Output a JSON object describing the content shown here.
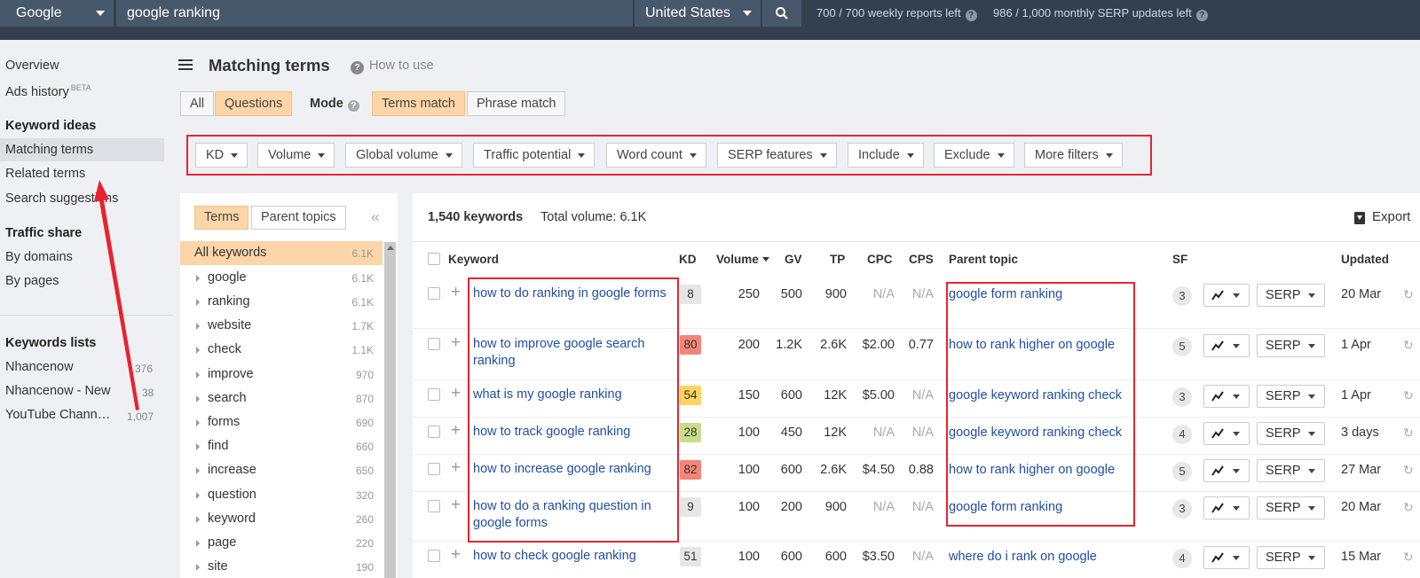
{
  "topbar": {
    "engine": "Google",
    "query": "google ranking",
    "country": "United States",
    "reports_left": "700 / 700 weekly reports left",
    "serp_updates_left": "986 / 1,000 monthly SERP updates left"
  },
  "sidebar": {
    "overview": "Overview",
    "ads_history": "Ads history",
    "beta": "BETA",
    "keyword_ideas": "Keyword ideas",
    "matching_terms": "Matching terms",
    "related_terms": "Related terms",
    "search_suggestions": "Search suggestions",
    "traffic_share": "Traffic share",
    "by_domains": "By domains",
    "by_pages": "By pages",
    "keywords_lists": "Keywords lists",
    "lists": [
      {
        "name": "Nhancenow",
        "count": "376"
      },
      {
        "name": "Nhancenow - New",
        "count": "38"
      },
      {
        "name": "YouTube Chann…",
        "count": "1,007"
      }
    ]
  },
  "header": {
    "title": "Matching terms",
    "how_to_use": "How to use",
    "tab_all": "All",
    "tab_questions": "Questions",
    "mode": "Mode",
    "terms_match": "Terms match",
    "phrase_match": "Phrase match"
  },
  "filters": [
    "KD",
    "Volume",
    "Global volume",
    "Traffic potential",
    "Word count",
    "SERP features",
    "Include",
    "Exclude",
    "More filters"
  ],
  "left_panel": {
    "tab_terms": "Terms",
    "tab_parent_topics": "Parent topics",
    "all_keywords": {
      "name": "All keywords",
      "count": "6.1K"
    },
    "terms": [
      {
        "name": "google",
        "count": "6.1K"
      },
      {
        "name": "ranking",
        "count": "6.1K"
      },
      {
        "name": "website",
        "count": "1.7K"
      },
      {
        "name": "check",
        "count": "1.1K"
      },
      {
        "name": "improve",
        "count": "970"
      },
      {
        "name": "search",
        "count": "870"
      },
      {
        "name": "forms",
        "count": "690"
      },
      {
        "name": "find",
        "count": "660"
      },
      {
        "name": "increase",
        "count": "650"
      },
      {
        "name": "question",
        "count": "320"
      },
      {
        "name": "keyword",
        "count": "260"
      },
      {
        "name": "page",
        "count": "220"
      },
      {
        "name": "site",
        "count": "190"
      }
    ]
  },
  "table": {
    "keyword_count": "1,540 keywords",
    "total_volume": "Total volume: 6.1K",
    "export": "Export",
    "headers": {
      "keyword": "Keyword",
      "kd": "KD",
      "volume": "Volume",
      "gv": "GV",
      "tp": "TP",
      "cpc": "CPC",
      "cps": "CPS",
      "parent_topic": "Parent topic",
      "sf": "SF",
      "updated": "Updated"
    },
    "serp_label": "SERP",
    "rows": [
      {
        "keyword": "how to do ranking in google forms",
        "kd": "8",
        "kd_color": "#e6e6e6",
        "volume": "250",
        "gv": "500",
        "tp": "900",
        "cpc": "N/A",
        "cps": "N/A",
        "parent": "google form ranking",
        "sf": "3",
        "updated": "20 Mar"
      },
      {
        "keyword": "how to improve google search ranking",
        "kd": "80",
        "kd_color": "#f4857a",
        "volume": "200",
        "gv": "1.2K",
        "tp": "2.6K",
        "cpc": "$2.00",
        "cps": "0.77",
        "parent": "how to rank higher on google",
        "sf": "5",
        "updated": "1 Apr"
      },
      {
        "keyword": "what is my google ranking",
        "kd": "54",
        "kd_color": "#fcd463",
        "volume": "150",
        "gv": "600",
        "tp": "12K",
        "cpc": "$5.00",
        "cps": "N/A",
        "parent": "google keyword ranking check",
        "sf": "3",
        "updated": "1 Apr"
      },
      {
        "keyword": "how to track google ranking",
        "kd": "28",
        "kd_color": "#c9dd8a",
        "volume": "100",
        "gv": "450",
        "tp": "12K",
        "cpc": "N/A",
        "cps": "N/A",
        "parent": "google keyword ranking check",
        "sf": "4",
        "updated": "3 days"
      },
      {
        "keyword": "how to increase google ranking",
        "kd": "82",
        "kd_color": "#f4857a",
        "volume": "100",
        "gv": "600",
        "tp": "2.6K",
        "cpc": "$4.50",
        "cps": "0.88",
        "parent": "how to rank higher on google",
        "sf": "5",
        "updated": "27 Mar"
      },
      {
        "keyword": "how to do a ranking question in google forms",
        "kd": "9",
        "kd_color": "#e6e6e6",
        "volume": "100",
        "gv": "200",
        "tp": "900",
        "cpc": "N/A",
        "cps": "N/A",
        "parent": "google form ranking",
        "sf": "3",
        "updated": "20 Mar"
      },
      {
        "keyword": "how to check google ranking",
        "kd": "51",
        "kd_color": "#e6e6e6",
        "volume": "100",
        "gv": "600",
        "tp": "600",
        "cpc": "$3.50",
        "cps": "N/A",
        "parent": "where do i rank on google",
        "sf": "4",
        "updated": "15 Mar"
      }
    ]
  }
}
